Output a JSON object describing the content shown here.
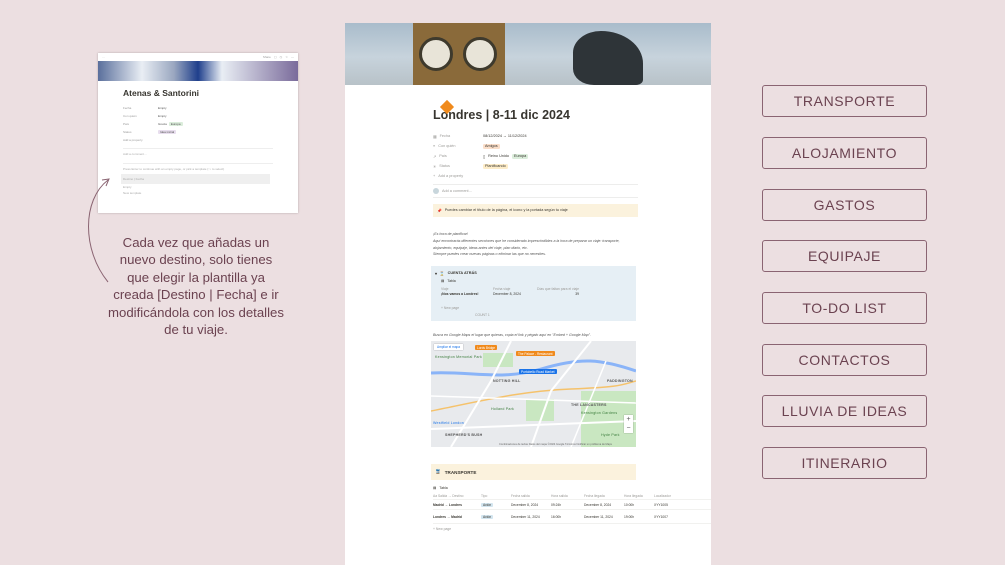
{
  "thumbnail": {
    "topbar_left": "…",
    "topbar_right": "Share",
    "title": "Atenas & Santorini",
    "props": [
      {
        "k": "Fecha",
        "v": "Empty"
      },
      {
        "k": "Con quién",
        "v": "Empty"
      },
      {
        "k": "País",
        "v": "Grecia",
        "tag": "Europa"
      },
      {
        "k": "Status",
        "v": "Idea inicial"
      },
      {
        "k": "Add a property",
        "v": ""
      }
    ],
    "comment": "Add a comment…",
    "hint": "Press Enter to continue with an empty page, or pick a template (↑↓ to select)",
    "templates": [
      "Destino | Fecha",
      "Empty",
      "New template"
    ]
  },
  "caption": "Cada vez que añadas un nuevo destino, solo tienes que elegir la plantilla ya creada [Destino | Fecha] e ir modificándola con los detalles de tu viaje.",
  "page": {
    "title": "Londres | 8-11 dic 2024",
    "props": [
      {
        "k": "Fecha",
        "v": "08/12/2024 → 11/12/2024"
      },
      {
        "k": "Con quién",
        "tag": "Amigos",
        "tag_color": "#fadec9"
      },
      {
        "k": "País",
        "v": "Reino Unido",
        "tag": "Europa",
        "tag_color": "#dbeddb"
      },
      {
        "k": "Status",
        "tag": "Planificando",
        "tag_color": "#fdecc8"
      },
      {
        "k": "Add a property"
      }
    ],
    "comment": "Add a comment…",
    "callout": "Puedes cambiar el título de la página, el icono y la portada según tu viaje",
    "intro": [
      "¡Es hora de planificar!",
      "Aquí encontrarás diferentes secciones que he considerado imprescindibles a la hora de preparar un viaje: transporte, alojamiento, equipaje, ideas antes del viaje, plan diario, etc.",
      "Siempre puedes crear nuevas páginas o eliminar las que no necesites."
    ],
    "countdown": {
      "title": "CUENTA ATRÁS",
      "view": "Tabla",
      "headers": [
        "Viaje",
        "Fecha viaje",
        "Días que faltan para el viaje"
      ],
      "row": [
        "¡Nos vamos a Londres!",
        "December 8, 2024",
        "39"
      ],
      "new_page": "+ New page",
      "count": "COUNT 1"
    },
    "map": {
      "label": "Busca en Google Maps el lugar que quieras, copia el link y pégalo aquí en \"Embed + Google Map\".",
      "open_btn": "Ampliar el mapa",
      "places": [
        "Lords Bridge",
        "The Palace - Restaurant",
        "Kensington Memorial Park",
        "Portobello Road Market",
        "NOTTING HILL",
        "PADDINGTON",
        "Holland Park",
        "THE LANCASTERS",
        "Westfield London",
        "SHEPHERD'S BUSH",
        "Hyde Park",
        "Kensington Gardens"
      ],
      "footer": "Combinaciones de teclas   Datos del mapa ©2024 Google   Términos   Notificar un problema de Maps"
    },
    "transport": {
      "title": "TRANSPORTE",
      "view": "Tabla",
      "headers": [
        "Aa Salida → Destino",
        "Tipo",
        "Fecha salida",
        "Hora salida",
        "Fecha llegada",
        "Hora llegada",
        "Localizador"
      ],
      "rows": [
        [
          "Madrid → Londres",
          "Avión",
          "December 8, 2024",
          "09:24h",
          "December 8, 2024",
          "10:00h",
          "XYY1005"
        ],
        [
          "Londres → Madrid",
          "Avión",
          "December 11, 2024",
          "16:00h",
          "December 11, 2024",
          "19:00h",
          "XYY1007"
        ]
      ],
      "new_page": "+ New page"
    }
  },
  "nav": [
    "TRANSPORTE",
    "ALOJAMIENTO",
    "GASTOS",
    "EQUIPAJE",
    "TO-DO LIST",
    "CONTACTOS",
    "LLUVIA DE IDEAS",
    "ITINERARIO"
  ]
}
